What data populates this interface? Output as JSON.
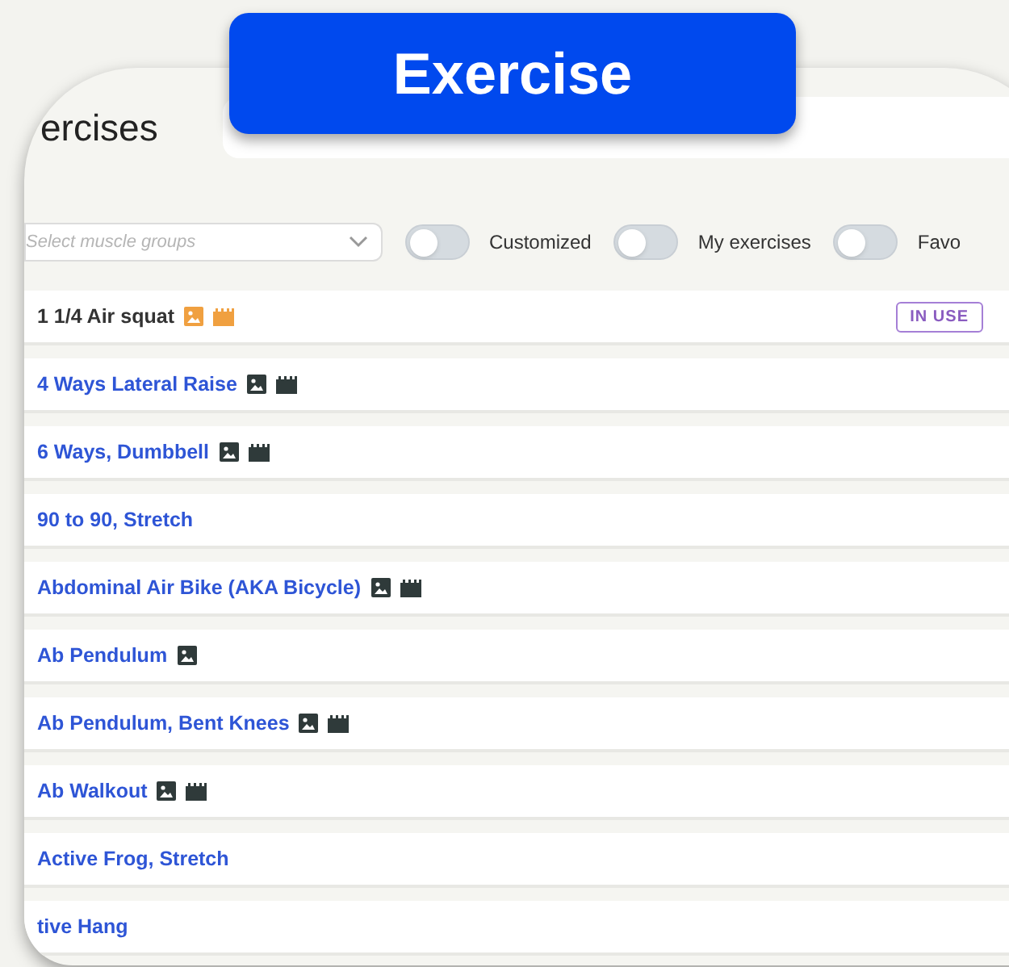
{
  "banner": {
    "title": "Exercise"
  },
  "header": {
    "title": "ercises"
  },
  "filters": {
    "select": {
      "placeholder": "Select muscle groups"
    },
    "toggles": [
      {
        "label": "Customized",
        "on": false
      },
      {
        "label": "My exercises",
        "on": false
      },
      {
        "label": "Favo",
        "on": false
      }
    ]
  },
  "exercises": [
    {
      "name": "1 1/4 Air squat",
      "in_use": true,
      "badge": "IN USE",
      "image": true,
      "video": true
    },
    {
      "name": "4 Ways Lateral Raise",
      "in_use": false,
      "image": true,
      "video": true
    },
    {
      "name": "6 Ways, Dumbbell",
      "in_use": false,
      "image": true,
      "video": true
    },
    {
      "name": "90 to 90, Stretch",
      "in_use": false,
      "image": false,
      "video": false
    },
    {
      "name": "Abdominal Air Bike (AKA Bicycle)",
      "in_use": false,
      "image": true,
      "video": true
    },
    {
      "name": "Ab Pendulum",
      "in_use": false,
      "image": true,
      "video": false
    },
    {
      "name": "Ab Pendulum, Bent Knees",
      "in_use": false,
      "image": true,
      "video": true
    },
    {
      "name": "Ab Walkout",
      "in_use": false,
      "image": true,
      "video": true
    },
    {
      "name": "Active Frog, Stretch",
      "in_use": false,
      "image": false,
      "video": false
    },
    {
      "name": "tive Hang",
      "in_use": false,
      "image": false,
      "video": false
    }
  ]
}
